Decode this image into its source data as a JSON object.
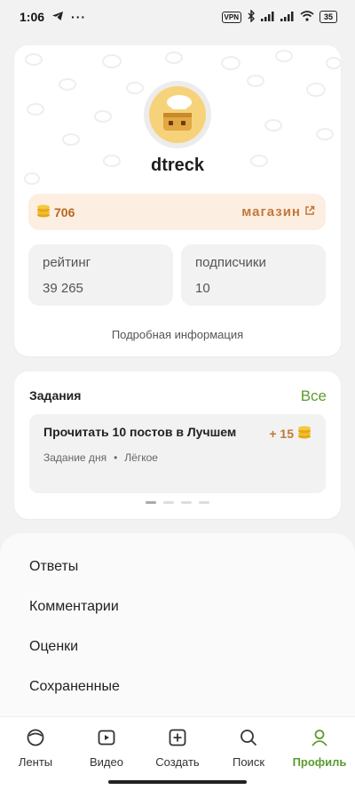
{
  "status": {
    "time": "1:06",
    "vpn": "VPN",
    "battery": "35"
  },
  "profile": {
    "username": "dtreck",
    "coins": "706",
    "shop_label": "магазин",
    "rating_label": "рейтинг",
    "rating_value": "39 265",
    "followers_label": "подписчики",
    "followers_value": "10",
    "more_info": "Подробная информация"
  },
  "tasks": {
    "title": "Задания",
    "all_label": "Все",
    "item": {
      "name": "Прочитать 10 постов в Лучшем",
      "reward": "+ 15",
      "type": "Задание дня",
      "separator": "•",
      "difficulty": "Лёгкое"
    },
    "page_count": 4,
    "active_page": 0
  },
  "menu": [
    "Ответы",
    "Комментарии",
    "Оценки",
    "Сохраненные"
  ],
  "nav": [
    {
      "label": "Ленты",
      "icon": "feeds-icon"
    },
    {
      "label": "Видео",
      "icon": "video-icon"
    },
    {
      "label": "Создать",
      "icon": "create-icon"
    },
    {
      "label": "Поиск",
      "icon": "search-icon"
    },
    {
      "label": "Профиль",
      "icon": "profile-icon"
    }
  ],
  "colors": {
    "accent": "#5b9c2f",
    "coin": "#c2783a",
    "coins_bg": "#fdeee2"
  }
}
